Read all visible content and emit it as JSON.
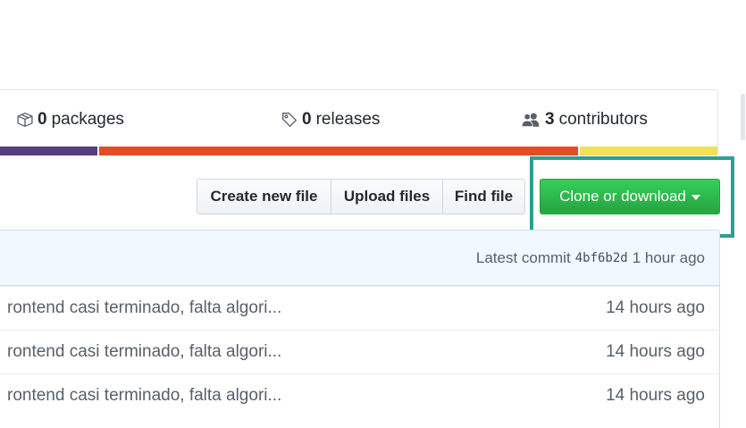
{
  "summary": {
    "packages": {
      "count": "0",
      "label": "packages",
      "icon": "package-icon"
    },
    "releases": {
      "count": "0",
      "label": "releases",
      "icon": "tag-icon"
    },
    "contributors": {
      "count": "3",
      "label": "contributors",
      "icon": "people-icon"
    }
  },
  "language_bar": [
    {
      "color": "#563d7c",
      "fraction": 0.138
    },
    {
      "color": "#e34c26",
      "fraction": 0.67
    },
    {
      "color": "#f1e05a",
      "fraction": 0.192
    }
  ],
  "toolbar": {
    "create_label": "Create new file",
    "upload_label": "Upload files",
    "find_label": "Find file",
    "clone_label": "Clone or download"
  },
  "commit": {
    "prefix": "Latest commit",
    "sha": "4bf6b2d",
    "age": "1 hour ago"
  },
  "files": [
    {
      "message": "rontend casi terminado, falta algori...",
      "age": "14 hours ago"
    },
    {
      "message": "rontend casi terminado, falta algori...",
      "age": "14 hours ago"
    },
    {
      "message": "rontend casi terminado, falta algori...",
      "age": "14 hours ago"
    }
  ],
  "colors": {
    "accent_green": "#28a745",
    "highlight": "#2c9f95"
  }
}
